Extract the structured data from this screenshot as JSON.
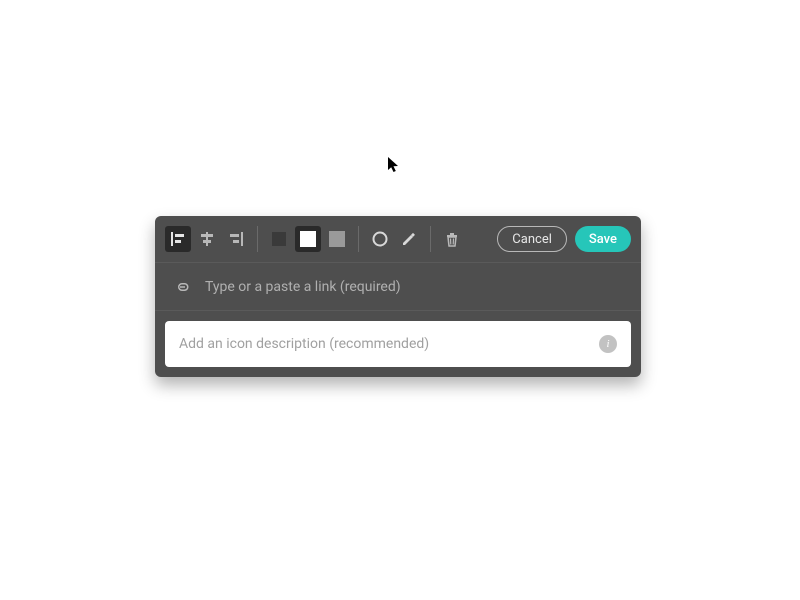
{
  "toolbar": {
    "cancel_label": "Cancel",
    "save_label": "Save"
  },
  "link": {
    "placeholder": "Type or a paste a link (required)",
    "value": ""
  },
  "description": {
    "placeholder": "Add an icon description (recommended)",
    "value": ""
  },
  "icons": {
    "align_left": "align-left-icon",
    "align_center": "align-center-icon",
    "align_right": "align-right-icon",
    "swatch_dark": "swatch-dark",
    "swatch_white": "swatch-white",
    "swatch_gray": "swatch-gray",
    "shape_circle": "circle-icon",
    "shape_edit": "edit-icon",
    "trash": "trash-icon",
    "link": "link-icon",
    "info": "info-icon"
  },
  "colors": {
    "panel": "#4e4e4e",
    "accent": "#26c6b9"
  }
}
